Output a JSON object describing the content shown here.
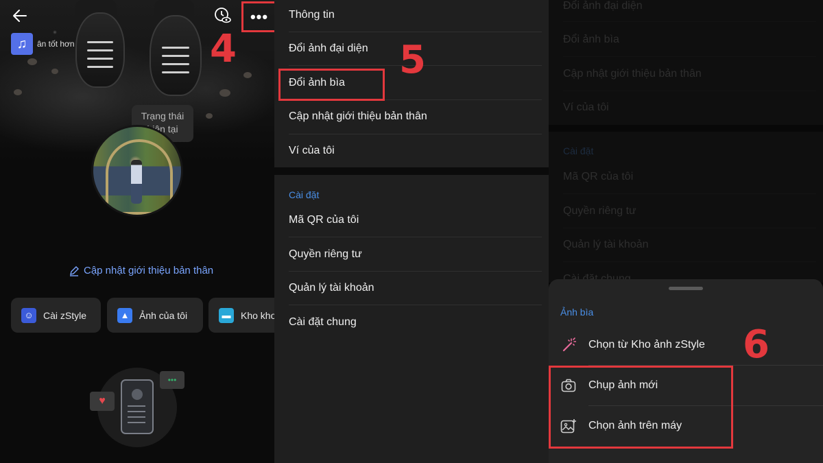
{
  "panel1": {
    "music_caption": "ân tốt hơn",
    "status_bubble": [
      "Trạng thái",
      "hiện tại"
    ],
    "bio_link": "Cập nhật giới thiệu bản thân",
    "chips": [
      "Cài zStyle",
      "Ảnh của tôi",
      "Kho kho"
    ],
    "step_label": "4"
  },
  "panel2": {
    "menu_top": [
      "Thông tin",
      "Đổi ảnh đại diện",
      "Đổi ảnh bìa",
      "Cập nhật giới thiệu bản thân",
      "Ví của tôi"
    ],
    "settings_title": "Cài đặt",
    "menu_settings": [
      "Mã QR của tôi",
      "Quyền riêng tư",
      "Quản lý tài khoản",
      "Cài đặt chung"
    ],
    "step_label": "5"
  },
  "panel3": {
    "dim_top": [
      "Đổi ảnh đại diện",
      "Đổi ảnh bìa",
      "Cập nhật giới thiệu bản thân",
      "Ví của tôi"
    ],
    "dim_settings_title": "Cài đặt",
    "dim_settings": [
      "Mã QR của tôi",
      "Quyền riêng tư",
      "Quản lý tài khoản",
      "Cài đặt chung"
    ],
    "sheet": {
      "title": "Ảnh bìa",
      "options": [
        "Chọn từ Kho ảnh zStyle",
        "Chụp ảnh mới",
        "Chọn ảnh trên máy"
      ]
    },
    "step_label": "6"
  },
  "colors": {
    "highlight": "#e3383d",
    "accent_blue": "#4a8fe7",
    "link_blue": "#7aa5ff"
  },
  "icons": {
    "back": "back-arrow-icon",
    "view_as": "eye-clock-icon",
    "more": "more-dots-icon",
    "music": "music-note-icon",
    "edit": "pencil-icon",
    "zstyle": "zstyle-icon",
    "photos": "photo-icon",
    "archive": "archive-box-icon",
    "magic": "magic-wand-icon",
    "camera": "camera-icon",
    "gallery": "gallery-add-icon"
  }
}
